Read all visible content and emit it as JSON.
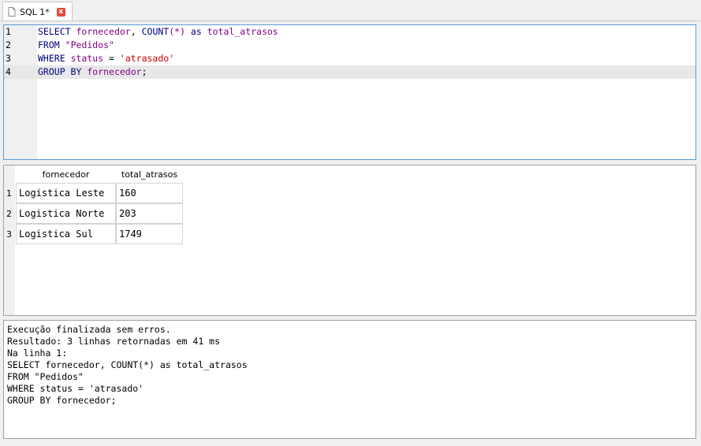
{
  "tab": {
    "title": "SQL 1*",
    "close_glyph": "x"
  },
  "editor": {
    "lines": [
      {
        "num": "1",
        "tokens": [
          {
            "t": "SELECT",
            "c": "kw"
          },
          {
            "t": " ",
            "c": "plain"
          },
          {
            "t": "fornecedor",
            "c": "id"
          },
          {
            "t": ", ",
            "c": "plain"
          },
          {
            "t": "COUNT",
            "c": "kw"
          },
          {
            "t": "(*)",
            "c": "id"
          },
          {
            "t": " as ",
            "c": "kw"
          },
          {
            "t": "total_atrasos",
            "c": "id"
          }
        ]
      },
      {
        "num": "2",
        "tokens": [
          {
            "t": "FROM",
            "c": "kw"
          },
          {
            "t": " ",
            "c": "plain"
          },
          {
            "t": "\"Pedidos\"",
            "c": "str"
          }
        ]
      },
      {
        "num": "3",
        "tokens": [
          {
            "t": "WHERE",
            "c": "kw"
          },
          {
            "t": " ",
            "c": "plain"
          },
          {
            "t": "status",
            "c": "id"
          },
          {
            "t": " = ",
            "c": "plain"
          },
          {
            "t": "'atrasado'",
            "c": "sq"
          }
        ]
      },
      {
        "num": "4",
        "tokens": [
          {
            "t": "GROUP BY",
            "c": "kw"
          },
          {
            "t": " ",
            "c": "plain"
          },
          {
            "t": "fornecedor",
            "c": "id"
          },
          {
            "t": ";",
            "c": "plain"
          }
        ]
      }
    ]
  },
  "results": {
    "columns": [
      "fornecedor",
      "total_atrasos"
    ],
    "rows": [
      {
        "num": "1",
        "cells": [
          "Logistica Leste",
          "160"
        ]
      },
      {
        "num": "2",
        "cells": [
          "Logistica Norte",
          "203"
        ]
      },
      {
        "num": "3",
        "cells": [
          "Logistica Sul",
          "1749"
        ]
      }
    ]
  },
  "log": {
    "lines": [
      "Execução finalizada sem erros.",
      "Resultado: 3 linhas retornadas em 41 ms",
      "Na linha 1:",
      "SELECT fornecedor, COUNT(*) as total_atrasos",
      "FROM \"Pedidos\"",
      "WHERE status = 'atrasado'",
      "GROUP BY fornecedor;"
    ]
  }
}
